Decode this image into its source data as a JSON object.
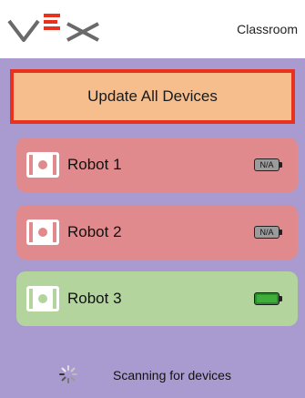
{
  "header": {
    "logo_text": "VEX",
    "title": "Classroom"
  },
  "update_button": {
    "label": "Update All Devices",
    "border_color": "#e8321e",
    "background": "#f6bd8d"
  },
  "robots": [
    {
      "name": "Robot 1",
      "status_color": "#e08a8e",
      "battery_label": "N/A",
      "battery_icon": "battery-na-icon"
    },
    {
      "name": "Robot 2",
      "status_color": "#e08a8e",
      "battery_label": "N/A",
      "battery_icon": "battery-na-icon"
    },
    {
      "name": "Robot 3",
      "status_color": "#b3d49d",
      "battery_label": "",
      "battery_icon": "battery-full-icon",
      "battery_level": 1.0
    }
  ],
  "status": {
    "text": "Scanning for devices",
    "icon": "spinner-icon"
  },
  "colors": {
    "panel_background": "#a99bd0",
    "disconnected": "#e08a8e",
    "connected": "#b3d49d",
    "battery_full": "#3fae3a"
  }
}
